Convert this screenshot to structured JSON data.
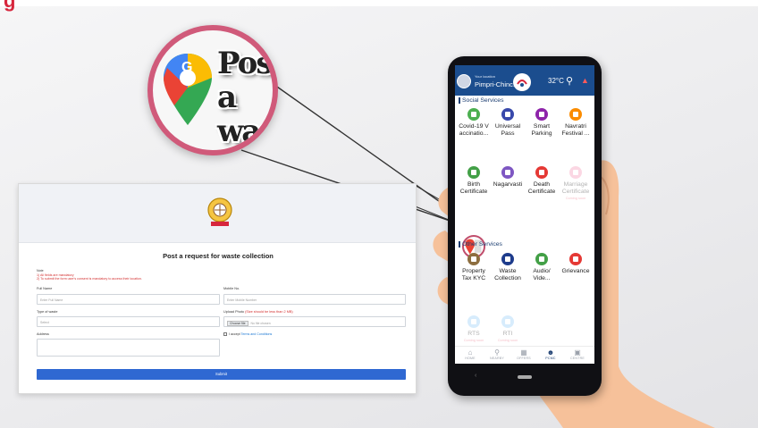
{
  "heading_fragment": "g",
  "bubble": {
    "text": "Post a waste",
    "icon": "google-maps-pin-icon"
  },
  "form": {
    "title": "Post a request for waste collection",
    "note_heading": "Note",
    "note_lines": [
      "1) All fields are mandatory",
      "2) To submit the form user's consent is mandatory to access their location."
    ],
    "full_name_label": "Full Name",
    "full_name_placeholder": "Enter Full Name",
    "mobile_label": "Mobile No.",
    "mobile_placeholder": "Enter Mobile Number",
    "waste_type_label": "Type of waste",
    "waste_type_value": "Select",
    "upload_label": "Upload Photo",
    "upload_hint": "(Size should be less than 2 MB)",
    "choose_file": "Choose file",
    "no_file": "No file chosen",
    "address_label": "Address",
    "accept_prefix": "I accept",
    "terms_link": "Terms and Conditions",
    "submit_label": "Submit"
  },
  "phone": {
    "location_label": "Your location",
    "location_value": "Pimpri-Chinc...",
    "temperature": "32°C",
    "social_header": "Social Services",
    "social_services": [
      {
        "label1": "Covid-19 V",
        "label2": "accinatio...",
        "color": "#4caf50"
      },
      {
        "label1": "Universal",
        "label2": "Pass",
        "color": "#3949ab"
      },
      {
        "label1": "Smart",
        "label2": "Parking",
        "color": "#8e24aa"
      },
      {
        "label1": "Navratri",
        "label2": "Festival ...",
        "color": "#fb8c00"
      },
      {
        "label1": "Birth",
        "label2": "Certificate",
        "color": "#43a047"
      },
      {
        "label1": "Nagarvasti",
        "label2": "",
        "color": "#7e57c2"
      },
      {
        "label1": "Death",
        "label2": "Certificate",
        "color": "#e53935"
      },
      {
        "label1": "Marriage",
        "label2": "Certificate",
        "color": "#f48fb1",
        "coming": "Coming soon"
      }
    ],
    "other_header": "Other Services",
    "other_services": [
      {
        "label1": "Property",
        "label2": "Tax KYC",
        "color": "#8d6e3f"
      },
      {
        "label1": "Waste",
        "label2": "Collection",
        "color": "#1e3c8c"
      },
      {
        "label1": "Audio/",
        "label2": "Vide...",
        "color": "#43a047"
      },
      {
        "label1": "Grievance",
        "label2": "",
        "color": "#e53935"
      },
      {
        "label1": "RTS",
        "label2": "",
        "color": "#90caf9",
        "coming": "Coming soon"
      },
      {
        "label1": "RTI",
        "label2": "",
        "color": "#90caf9",
        "coming": "Coming soon"
      }
    ],
    "bottom_nav": [
      "HOME",
      "NEARBY",
      "OFFERS",
      "PCMC",
      "CENTRE"
    ]
  }
}
